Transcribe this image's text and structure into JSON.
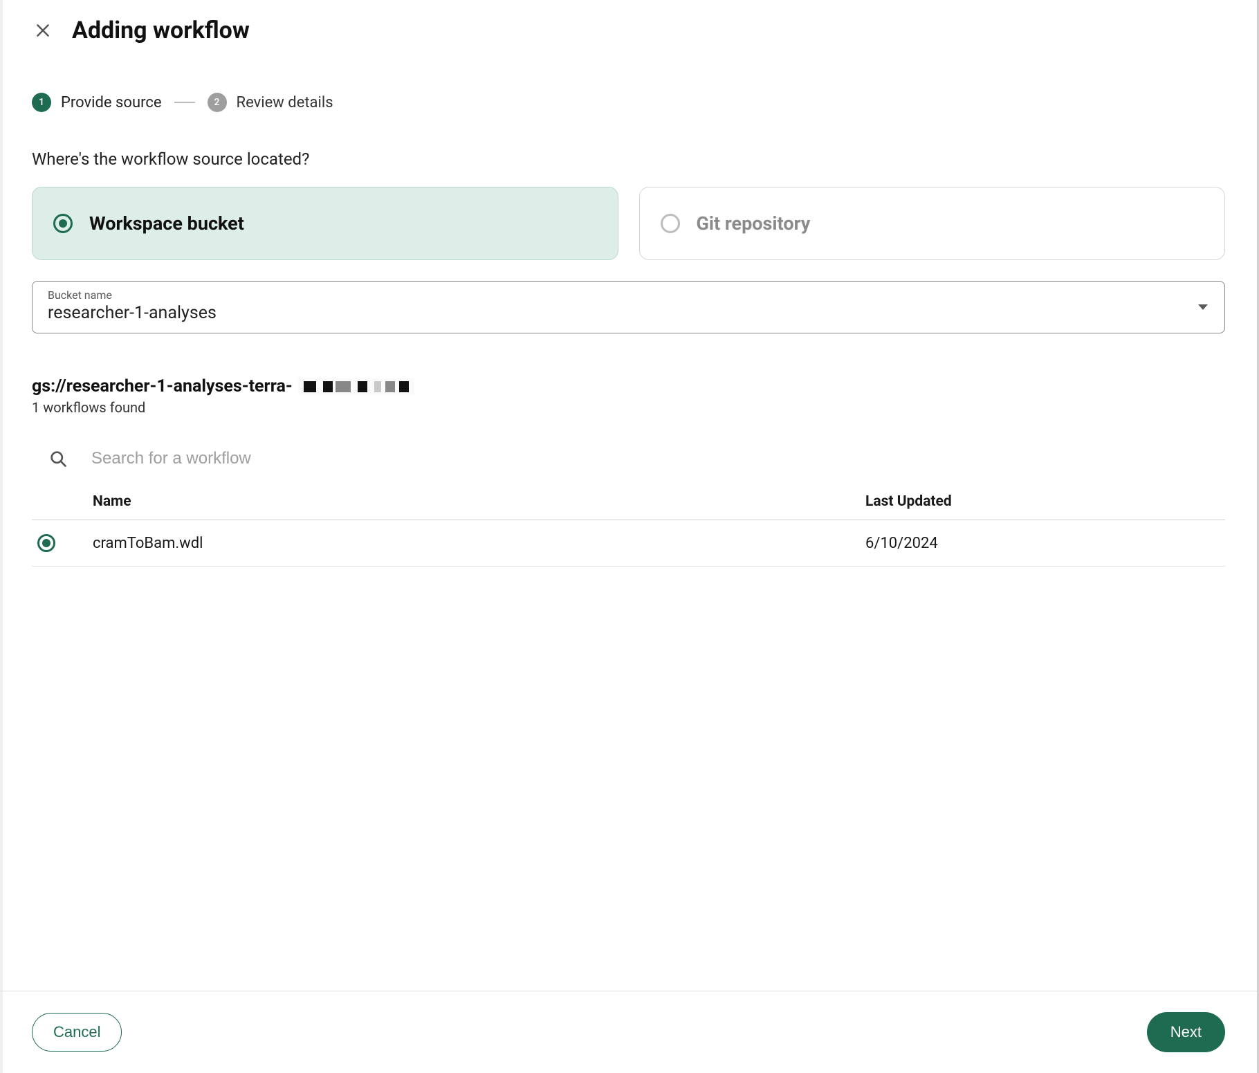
{
  "header": {
    "title": "Adding workflow"
  },
  "stepper": {
    "steps": [
      {
        "number": "1",
        "label": "Provide source",
        "active": true
      },
      {
        "number": "2",
        "label": "Review details",
        "active": false
      }
    ]
  },
  "question": "Where's the workflow source located?",
  "sourceOptions": {
    "workspace": {
      "label": "Workspace bucket",
      "selected": true
    },
    "git": {
      "label": "Git repository",
      "selected": false
    }
  },
  "bucketSelect": {
    "label": "Bucket name",
    "value": "researcher-1-analyses"
  },
  "bucketPath": {
    "prefix": "gs://researcher-1-analyses-terra-",
    "countLine": "1 workflows found"
  },
  "search": {
    "placeholder": "Search for a workflow"
  },
  "table": {
    "headers": {
      "name": "Name",
      "updated": "Last Updated"
    },
    "rows": [
      {
        "name": "cramToBam.wdl",
        "updated": "6/10/2024",
        "selected": true
      }
    ]
  },
  "footer": {
    "cancel": "Cancel",
    "next": "Next"
  }
}
